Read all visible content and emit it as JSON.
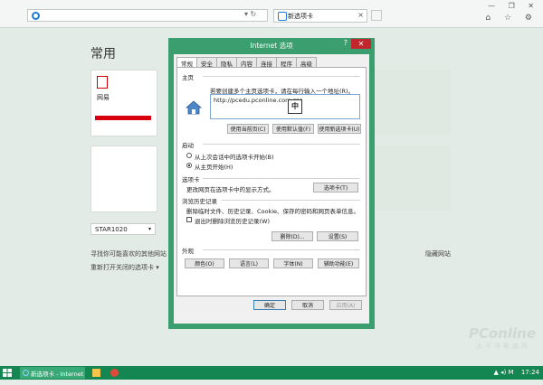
{
  "browser": {
    "address_value": "",
    "tab_title": "新选项卡",
    "addr_buttons": "▾ ↻",
    "window_controls": "— ❐ ✕",
    "tool_icons": "⌂ ☆ ⚙"
  },
  "new_tab_page": {
    "heading": "常用",
    "tile_site_name": "网易",
    "dropdown_value": "STAR1020",
    "link_more_sites": "寻找你可能喜欢的其他网站",
    "link_reopen": "重新打开关闭的选项卡",
    "link_reopen_arrow": "▾",
    "link_hide_sites": "隐藏网站"
  },
  "dialog": {
    "title": "Internet 选项",
    "help": "?",
    "close": "✕",
    "tabs": [
      "常规",
      "安全",
      "隐私",
      "内容",
      "连接",
      "程序",
      "高级"
    ],
    "home_section": "主页",
    "home_desc": "若要创建多个主页选项卡，请在每行输入一个地址(R)。",
    "home_url": "http://pcedu.pconline.com.cn/",
    "ime_char": "中",
    "btn_use_current": "使用当前页(C)",
    "btn_use_default": "使用默认值(F)",
    "btn_use_new_tab": "使用新选项卡(U)",
    "startup_section": "启动",
    "radio_last_session": "从上次会话中的选项卡开始(B)",
    "radio_home_page": "从主页开始(H)",
    "tabs_section": "选项卡",
    "tabs_desc": "更改网页在选项卡中的显示方式。",
    "btn_tabs": "选项卡(T)",
    "history_section": "浏览历史记录",
    "history_desc": "删除临时文件、历史记录、Cookie、保存的密码和网页表单信息。",
    "chk_delete_on_exit": "退出时删除浏览历史记录(W)",
    "btn_delete": "删除(D)...",
    "btn_settings": "设置(S)",
    "appearance_section": "外观",
    "btn_colors": "颜色(O)",
    "btn_languages": "语言(L)",
    "btn_fonts": "字体(N)",
    "btn_accessibility": "辅助功能(E)",
    "btn_ok": "确定",
    "btn_cancel": "取消",
    "btn_apply": "应用(A)"
  },
  "taskbar": {
    "active_item": "新选项卡 - Internet ...",
    "tray_text": "▲ ◂) M",
    "time": "17:24"
  },
  "watermark": {
    "brand": "PConline",
    "tagline": "太平洋电脑网"
  }
}
